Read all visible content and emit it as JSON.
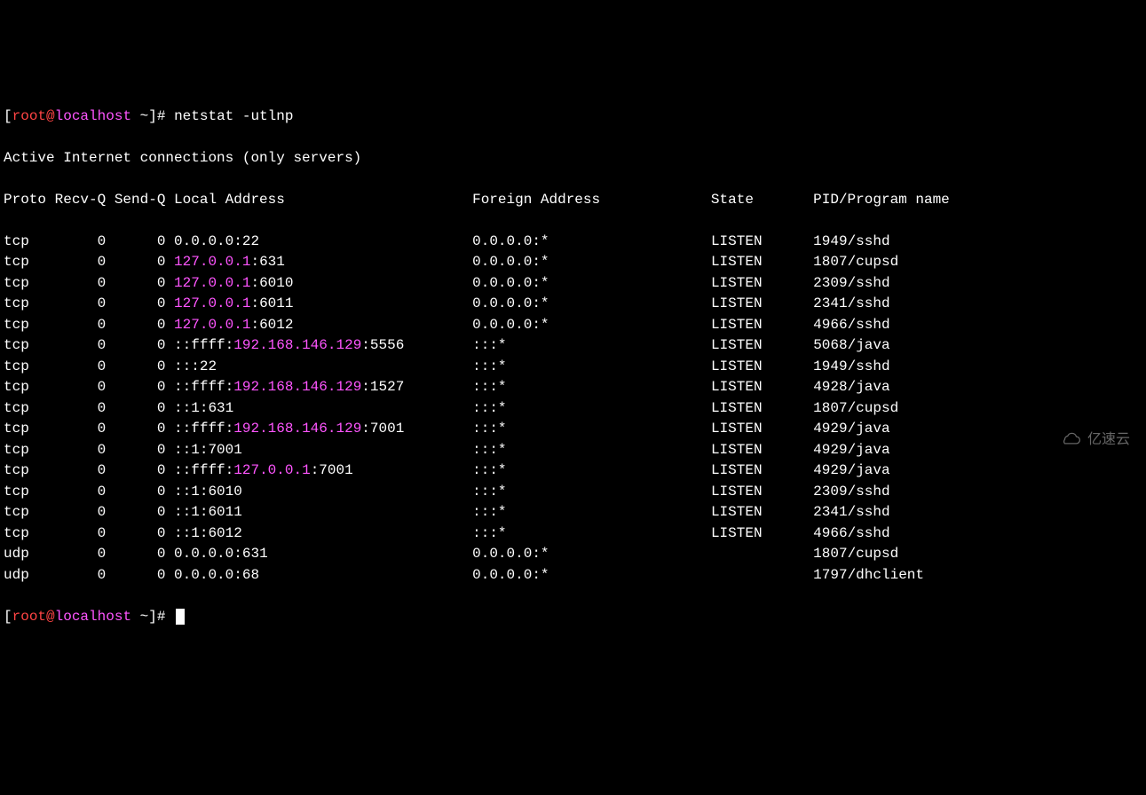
{
  "prompt": {
    "open": "[",
    "user": "root",
    "at": "@",
    "host": "localhost",
    "tilde": " ~",
    "close": "]",
    "hash": "# "
  },
  "command": "netstat -utlnp",
  "title_line": "Active Internet connections (only servers)",
  "headers": {
    "proto": "Proto",
    "recvq": "Recv-Q",
    "sendq": "Send-Q",
    "local": "Local Address",
    "foreign": "Foreign Address",
    "state": "State",
    "pidprog": "PID/Program name"
  },
  "rows": [
    {
      "proto": "tcp",
      "recvq": "0",
      "sendq": "0",
      "la_pre": "",
      "la_ip": "",
      "la_post": "0.0.0.0:22",
      "fa": "0.0.0.0:*",
      "state": "LISTEN",
      "pid": "1949/sshd"
    },
    {
      "proto": "tcp",
      "recvq": "0",
      "sendq": "0",
      "la_pre": "",
      "la_ip": "127.0.0.1",
      "la_post": ":631",
      "fa": "0.0.0.0:*",
      "state": "LISTEN",
      "pid": "1807/cupsd"
    },
    {
      "proto": "tcp",
      "recvq": "0",
      "sendq": "0",
      "la_pre": "",
      "la_ip": "127.0.0.1",
      "la_post": ":6010",
      "fa": "0.0.0.0:*",
      "state": "LISTEN",
      "pid": "2309/sshd"
    },
    {
      "proto": "tcp",
      "recvq": "0",
      "sendq": "0",
      "la_pre": "",
      "la_ip": "127.0.0.1",
      "la_post": ":6011",
      "fa": "0.0.0.0:*",
      "state": "LISTEN",
      "pid": "2341/sshd"
    },
    {
      "proto": "tcp",
      "recvq": "0",
      "sendq": "0",
      "la_pre": "",
      "la_ip": "127.0.0.1",
      "la_post": ":6012",
      "fa": "0.0.0.0:*",
      "state": "LISTEN",
      "pid": "4966/sshd"
    },
    {
      "proto": "tcp",
      "recvq": "0",
      "sendq": "0",
      "la_pre": "::ffff:",
      "la_ip": "192.168.146.129",
      "la_post": ":5556",
      "fa": ":::*",
      "state": "LISTEN",
      "pid": "5068/java"
    },
    {
      "proto": "tcp",
      "recvq": "0",
      "sendq": "0",
      "la_pre": "",
      "la_ip": "",
      "la_post": ":::22",
      "fa": ":::*",
      "state": "LISTEN",
      "pid": "1949/sshd"
    },
    {
      "proto": "tcp",
      "recvq": "0",
      "sendq": "0",
      "la_pre": "::ffff:",
      "la_ip": "192.168.146.129",
      "la_post": ":1527",
      "fa": ":::*",
      "state": "LISTEN",
      "pid": "4928/java"
    },
    {
      "proto": "tcp",
      "recvq": "0",
      "sendq": "0",
      "la_pre": "",
      "la_ip": "",
      "la_post": "::1:631",
      "fa": ":::*",
      "state": "LISTEN",
      "pid": "1807/cupsd"
    },
    {
      "proto": "tcp",
      "recvq": "0",
      "sendq": "0",
      "la_pre": "::ffff:",
      "la_ip": "192.168.146.129",
      "la_post": ":7001",
      "fa": ":::*",
      "state": "LISTEN",
      "pid": "4929/java"
    },
    {
      "proto": "tcp",
      "recvq": "0",
      "sendq": "0",
      "la_pre": "",
      "la_ip": "",
      "la_post": "::1:7001",
      "fa": ":::*",
      "state": "LISTEN",
      "pid": "4929/java"
    },
    {
      "proto": "tcp",
      "recvq": "0",
      "sendq": "0",
      "la_pre": "::ffff:",
      "la_ip": "127.0.0.1",
      "la_post": ":7001",
      "fa": ":::*",
      "state": "LISTEN",
      "pid": "4929/java"
    },
    {
      "proto": "tcp",
      "recvq": "0",
      "sendq": "0",
      "la_pre": "",
      "la_ip": "",
      "la_post": "::1:6010",
      "fa": ":::*",
      "state": "LISTEN",
      "pid": "2309/sshd"
    },
    {
      "proto": "tcp",
      "recvq": "0",
      "sendq": "0",
      "la_pre": "",
      "la_ip": "",
      "la_post": "::1:6011",
      "fa": ":::*",
      "state": "LISTEN",
      "pid": "2341/sshd"
    },
    {
      "proto": "tcp",
      "recvq": "0",
      "sendq": "0",
      "la_pre": "",
      "la_ip": "",
      "la_post": "::1:6012",
      "fa": ":::*",
      "state": "LISTEN",
      "pid": "4966/sshd"
    },
    {
      "proto": "udp",
      "recvq": "0",
      "sendq": "0",
      "la_pre": "",
      "la_ip": "",
      "la_post": "0.0.0.0:631",
      "fa": "0.0.0.0:*",
      "state": "",
      "pid": "1807/cupsd"
    },
    {
      "proto": "udp",
      "recvq": "0",
      "sendq": "0",
      "la_pre": "",
      "la_ip": "",
      "la_post": "0.0.0.0:68",
      "fa": "0.0.0.0:*",
      "state": "",
      "pid": "1797/dhclient"
    }
  ],
  "watermark": "亿速云"
}
